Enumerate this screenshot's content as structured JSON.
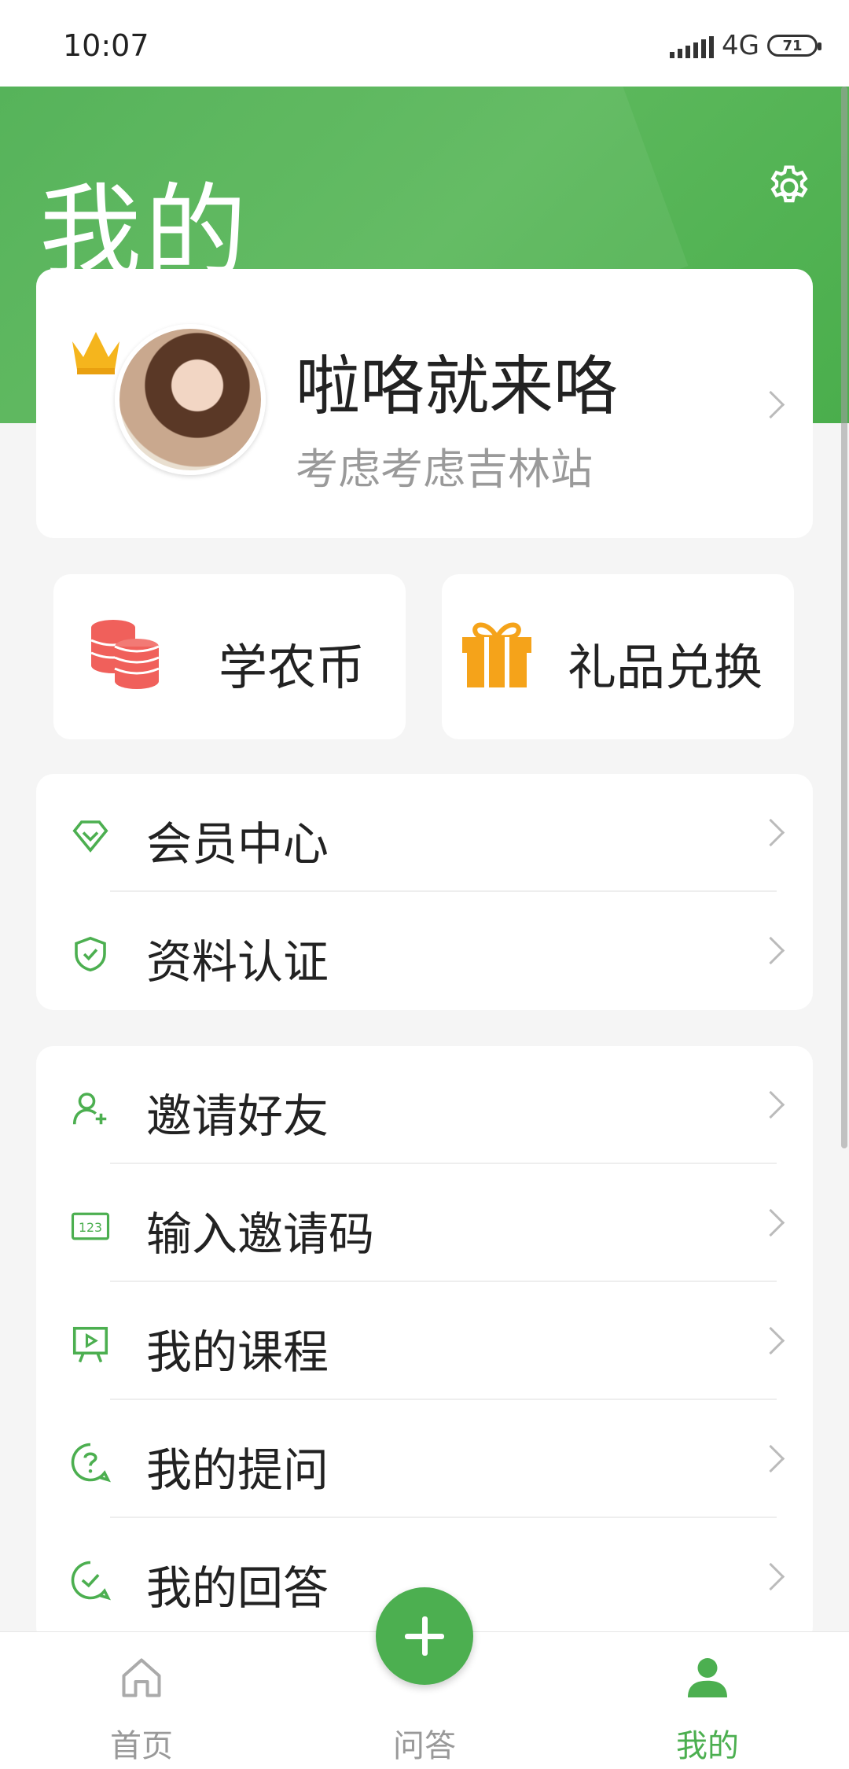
{
  "status_bar": {
    "time": "10:07",
    "network": "4G",
    "battery": "71"
  },
  "header": {
    "title": "我的"
  },
  "profile": {
    "name": "啦咯就来咯",
    "subtitle": "考虑考虑吉林站"
  },
  "tiles": [
    {
      "label": "学农币",
      "icon": "coins-icon"
    },
    {
      "label": "礼品兑换",
      "icon": "gift-icon"
    }
  ],
  "menu_group_1": [
    {
      "label": "会员中心",
      "icon": "diamond-icon"
    },
    {
      "label": "资料认证",
      "icon": "shield-check-icon"
    }
  ],
  "menu_group_2": [
    {
      "label": "邀请好友",
      "icon": "add-user-icon"
    },
    {
      "label": "输入邀请码",
      "icon": "code-123-icon"
    },
    {
      "label": "我的课程",
      "icon": "video-board-icon"
    },
    {
      "label": "我的提问",
      "icon": "question-bubble-icon"
    },
    {
      "label": "我的回答",
      "icon": "check-bubble-icon"
    }
  ],
  "bottom_nav": [
    {
      "label": "首页",
      "icon": "home-icon"
    },
    {
      "label": "问答",
      "icon": "add-icon"
    },
    {
      "label": "我的",
      "icon": "person-icon",
      "active": true
    }
  ],
  "colors": {
    "accent": "#4caf50",
    "coin": "#f0605b",
    "gift": "#f5a31a"
  }
}
